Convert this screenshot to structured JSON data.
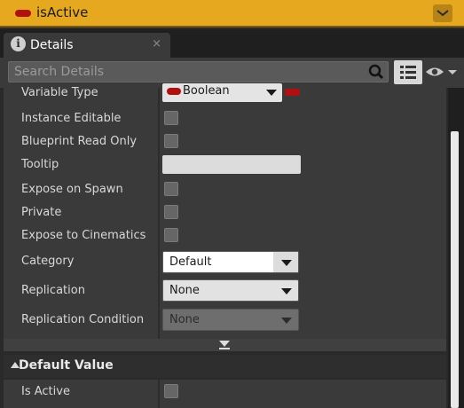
{
  "variable": {
    "name": "isActive",
    "type_color": "#b01010"
  },
  "tab": {
    "label": "Details",
    "close": "×"
  },
  "search": {
    "placeholder": "Search Details"
  },
  "properties": [
    {
      "label": "Variable Type",
      "value": "Boolean"
    },
    {
      "label": "Instance Editable",
      "checked": false
    },
    {
      "label": "Blueprint Read Only",
      "checked": false
    },
    {
      "label": "Tooltip",
      "value": ""
    },
    {
      "label": "Expose on Spawn",
      "checked": false
    },
    {
      "label": "Private",
      "checked": false
    },
    {
      "label": "Expose to Cinematics",
      "checked": false
    },
    {
      "label": "Category",
      "value": "Default"
    },
    {
      "label": "Replication",
      "value": "None"
    },
    {
      "label": "Replication Condition",
      "value": "None"
    }
  ],
  "default_value": {
    "title": "Default Value",
    "items": [
      {
        "label": "Is Active",
        "checked": false
      }
    ]
  },
  "colors": {
    "accent": "#e6a81e",
    "panel": "#3a3a3a",
    "boolean_pin": "#b01010"
  },
  "icons": [
    "info-icon",
    "search-icon",
    "grid-view-icon",
    "eye-icon",
    "chevron-down-icon"
  ]
}
